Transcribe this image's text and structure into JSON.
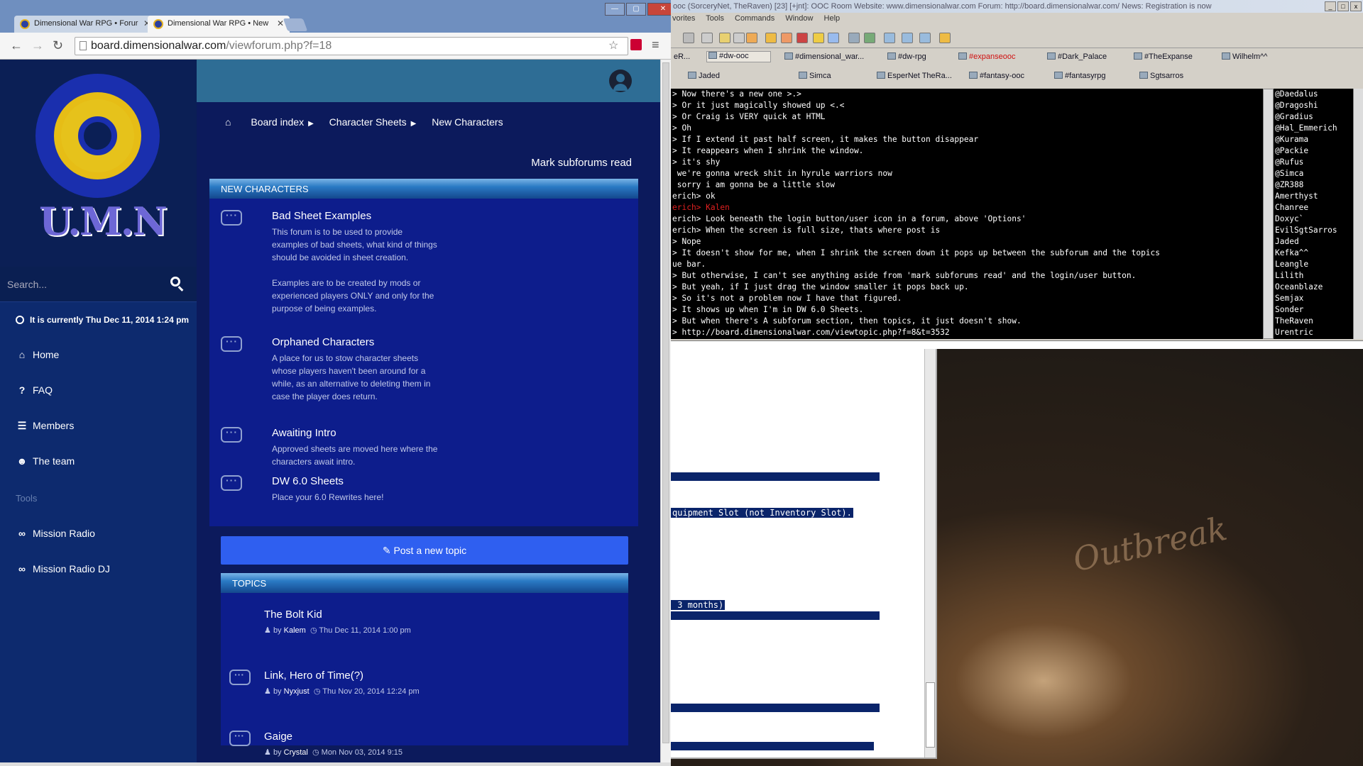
{
  "browser": {
    "tabs": [
      {
        "label": "Dimensional War RPG • Forur",
        "close": "✕"
      },
      {
        "label": "Dimensional War RPG • New",
        "close": "✕"
      }
    ],
    "window_buttons": [
      "—",
      "▢",
      "✕"
    ],
    "url_host": "board.dimensionalwar.com",
    "url_path": "/viewforum.php?f=18"
  },
  "sidebar": {
    "logo_text": "U.M.N",
    "search_placeholder": "Search...",
    "current_time": "It is currently Thu Dec 11, 2014 1:24 pm",
    "nav": [
      {
        "icon": "home-icon",
        "glyph": "⌂",
        "label": "Home"
      },
      {
        "icon": "question-icon",
        "glyph": "?",
        "label": "FAQ"
      },
      {
        "icon": "list-icon",
        "glyph": "☰",
        "label": "Members"
      },
      {
        "icon": "users-icon",
        "glyph": "☻",
        "label": "The team"
      }
    ],
    "tools_heading": "Tools",
    "tools": [
      {
        "icon": "link-icon",
        "glyph": "∞",
        "label": "Mission Radio"
      },
      {
        "icon": "link-icon",
        "glyph": "∞",
        "label": "Mission Radio DJ"
      }
    ]
  },
  "main": {
    "breadcrumbs": [
      "Board index",
      "Character Sheets",
      "New Characters"
    ],
    "mark_read": "Mark subforums read",
    "section_title": "NEW CHARACTERS",
    "forums": [
      {
        "title": "Bad Sheet Examples",
        "desc": "This forum is to be used to provide examples of bad sheets, what kind of things should be avoided in sheet creation.\n\nExamples are to be created by mods or experienced players ONLY and only for the purpose of being examples."
      },
      {
        "title": "Orphaned Characters",
        "desc": "A place for us to stow character sheets whose players haven't been around for a while, as an alternative to deleting them in case the player does return."
      },
      {
        "title": "Awaiting Intro",
        "desc": "Approved sheets are moved here where the characters await intro."
      },
      {
        "title": "DW 6.0 Sheets",
        "desc": "Place your 6.0 Rewrites here!"
      }
    ],
    "post_button": "Post a new topic",
    "topics_title": "TOPICS",
    "topics": [
      {
        "title": "The Bolt Kid",
        "by": "by",
        "author": "Kalem",
        "date": "Thu Dec 11, 2014 1:00 pm"
      },
      {
        "title": "Link, Hero of Time(?)",
        "by": "by",
        "author": "Nyxjust",
        "date": "Thu Nov 20, 2014 12:24 pm"
      },
      {
        "title": "Gaige",
        "by": "by",
        "author": "Crystal",
        "date": "Mon Nov 03, 2014 9:15"
      }
    ]
  },
  "irc": {
    "title": "ooc (SorceryNet, TheRaven) [23] [+jnt]: OOC Room Website: www.dimensionalwar.com Forum: http://board.dimensionalwar.com/ News: Registration is now",
    "menu": [
      "vorites",
      "Tools",
      "Commands",
      "Window",
      "Help"
    ],
    "channels_row1": [
      {
        "label": "eR...",
        "red": false
      },
      {
        "label": "#dw-ooc",
        "red": false,
        "selected": true
      },
      {
        "label": "#dimensional_war...",
        "red": false
      },
      {
        "label": "#dw-rpg",
        "red": false
      },
      {
        "label": "#expanseooc",
        "red": true
      },
      {
        "label": "#Dark_Palace",
        "red": false
      },
      {
        "label": "#TheExpanse",
        "red": false
      },
      {
        "label": "Wilhelm^^",
        "red": false
      }
    ],
    "channels_row2": [
      {
        "label": "Jaded"
      },
      {
        "label": "Simca"
      },
      {
        "label": "EsperNet TheRa..."
      },
      {
        "label": "#fantasy-ooc"
      },
      {
        "label": "#fantasyrpg"
      },
      {
        "label": "Sgtsarros"
      }
    ],
    "chat_lines": [
      {
        "text": "> Now there's a new one >.>",
        "red": false
      },
      {
        "text": "> Or it just magically showed up <.<",
        "red": false
      },
      {
        "text": "> Or Craig is VERY quick at HTML",
        "red": false
      },
      {
        "text": "> Oh",
        "red": false
      },
      {
        "text": "> If I extend it past half screen, it makes the button disappear",
        "red": false
      },
      {
        "text": "> It reappears when I shrink the window.",
        "red": false
      },
      {
        "text": "> it's shy",
        "red": false
      },
      {
        "text": " we're gonna wreck shit in hyrule warriors now",
        "red": false
      },
      {
        "text": " sorry i am gonna be a little slow",
        "red": false
      },
      {
        "text": "erich> ok",
        "red": false
      },
      {
        "text": "erich> Kalen",
        "red": true
      },
      {
        "text": "erich> Look beneath the login button/user icon in a forum, above 'Options'",
        "red": false
      },
      {
        "text": "erich> When the screen is full size, thats where post is",
        "red": false
      },
      {
        "text": "> Nope",
        "red": false
      },
      {
        "text": "> It doesn't show for me, when I shrink the screen down it pops up between the subforum and the topics",
        "red": false
      },
      {
        "text": "ue bar.",
        "red": false
      },
      {
        "text": "> But otherwise, I can't see anything aside from 'mark subforums read' and the login/user button.",
        "red": false
      },
      {
        "text": "> But yeah, if I just drag the window smaller it pops back up.",
        "red": false
      },
      {
        "text": "> So it's not a problem now I have that figured.",
        "red": false
      },
      {
        "text": "> It shows up when I'm in DW 6.0 Sheets.",
        "red": false
      },
      {
        "text": "> But when there's A subforum section, then topics, it just doesn't show.",
        "red": false
      },
      {
        "text": "> http://board.dimensionalwar.com/viewtopic.php?f=8&t=3532",
        "red": false
      }
    ],
    "nicks": [
      "@Daedalus",
      "@Dragoshi",
      "@Gradius",
      "@Hal_Emmerich",
      "@Kurama",
      "@Packie",
      "@Rufus",
      "@Simca",
      "@ZR388",
      "Amerthyst",
      "Chanree",
      "Doxyc`",
      "EvilSgtSarros",
      "Jaded",
      "Kefka^^",
      "Leangle",
      "Lilith",
      "Oceanblaze",
      "Semjax",
      "Sonder",
      "TheRaven",
      "Urentric"
    ]
  },
  "editor": {
    "selected_1": "quipment Slot (not Inventory Slot).",
    "selected_2": " 3 months)"
  },
  "desktop": {
    "signature": "Outbreak"
  }
}
